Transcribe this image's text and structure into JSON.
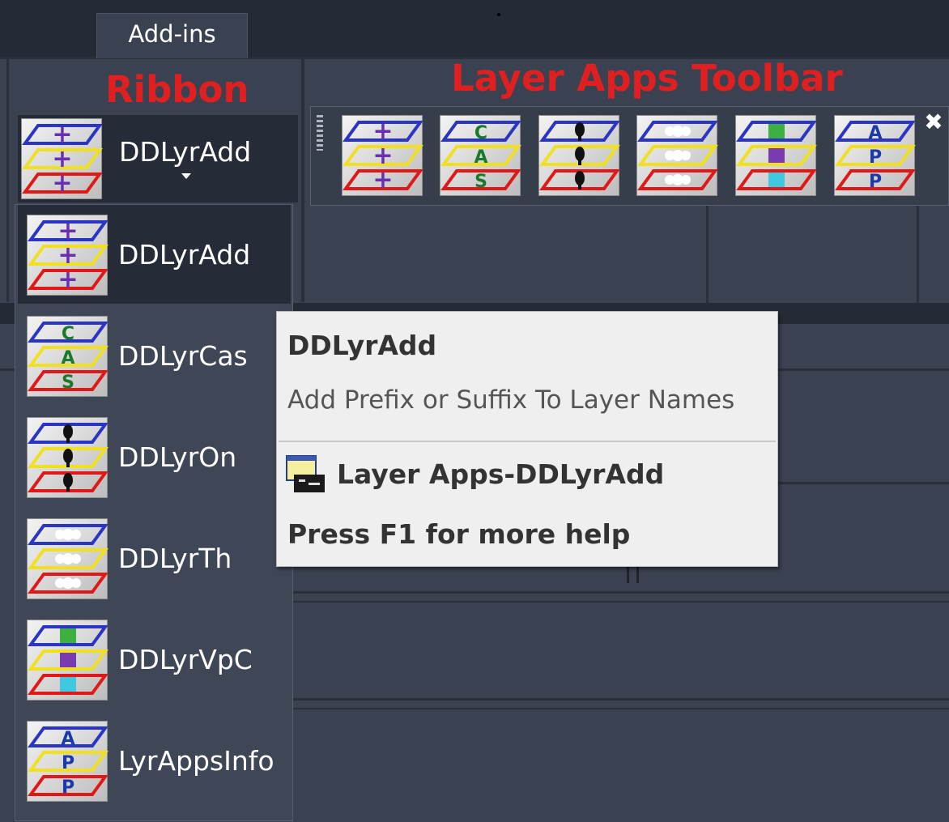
{
  "tab": {
    "label": "Add-ins"
  },
  "captions": {
    "ribbon": "Ribbon",
    "toolbar": "Layer Apps Toolbar"
  },
  "split_button": {
    "label": "DDLyrAdd",
    "icon": "layer-add-icon"
  },
  "toolbar": {
    "buttons": [
      {
        "name": "DDLyrAdd",
        "icon": "layer-add-icon"
      },
      {
        "name": "DDLyrCas",
        "icon": "layer-case-icon"
      },
      {
        "name": "DDLyrOn",
        "icon": "layer-on-icon"
      },
      {
        "name": "DDLyrTh",
        "icon": "layer-thaw-icon"
      },
      {
        "name": "DDLyrVpC",
        "icon": "layer-viewport-color-icon"
      },
      {
        "name": "LyrAppsInfo",
        "icon": "layer-apps-info-icon"
      }
    ],
    "close_icon": "close-icon"
  },
  "menu": {
    "items": [
      {
        "label": "DDLyrAdd",
        "icon": "layer-add-icon",
        "selected": true
      },
      {
        "label": "DDLyrCas",
        "icon": "layer-case-icon"
      },
      {
        "label": "DDLyrOn",
        "icon": "layer-on-icon"
      },
      {
        "label": "DDLyrTh",
        "icon": "layer-thaw-icon"
      },
      {
        "label": "DDLyrVpC",
        "icon": "layer-viewport-color-icon"
      },
      {
        "label": "LyrAppsInfo",
        "icon": "layer-apps-info-icon"
      }
    ]
  },
  "tooltip": {
    "title": "DDLyrAdd",
    "description": "Add Prefix or Suffix To Layer Names",
    "help_link": "Layer Apps-DDLyrAdd",
    "help_hint": "Press F1 for more help",
    "help_icon": "help-window-icon"
  },
  "colors": {
    "caption_red": "#e02020",
    "layer_blue": "#2a35c4",
    "layer_yellow": "#f0e020",
    "layer_red": "#e01818",
    "plus_purple": "#6a2fb0",
    "letter_green": "#1a7a2a",
    "letter_blue": "#1a3aa8",
    "dark_panel": "#262c37",
    "window_bg": "#3a4252"
  }
}
